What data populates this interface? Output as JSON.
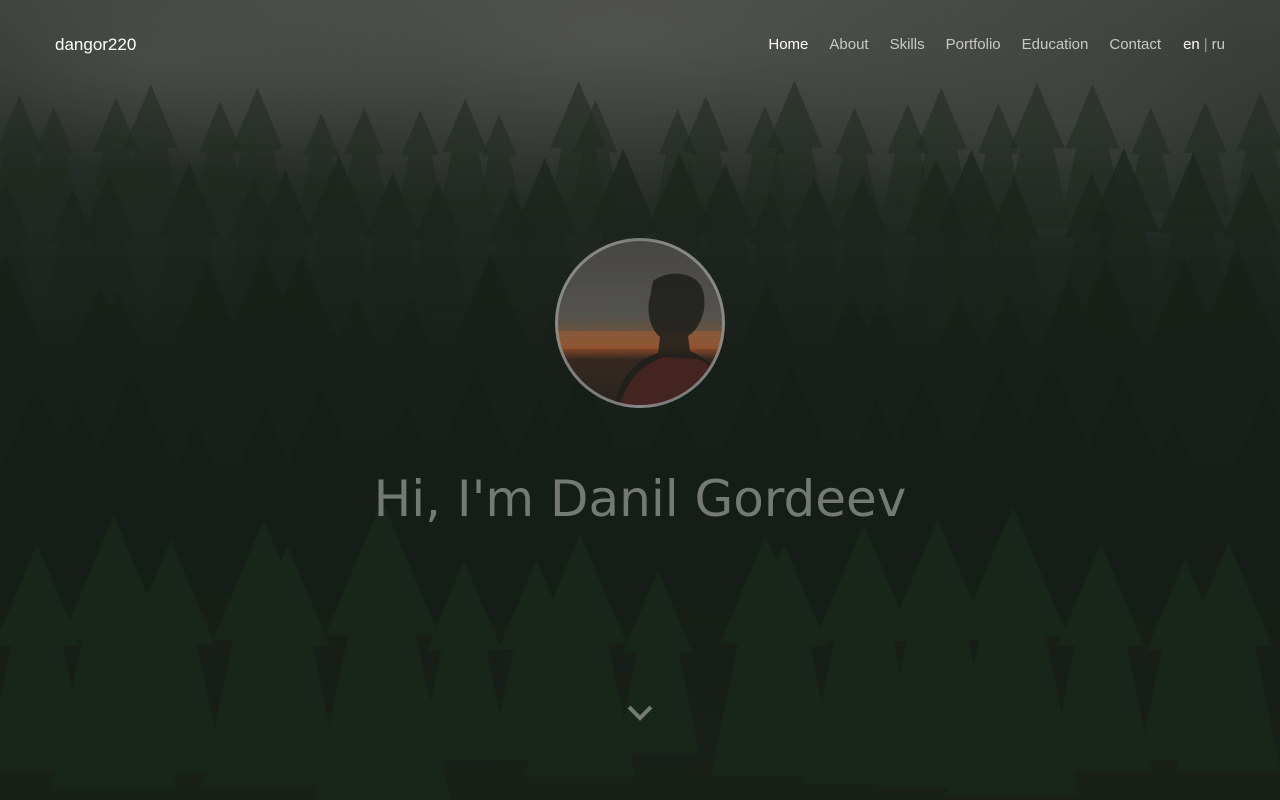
{
  "brand": {
    "name": "dangor220"
  },
  "nav": {
    "items": [
      {
        "label": "Home",
        "active": true
      },
      {
        "label": "About",
        "active": false
      },
      {
        "label": "Skills",
        "active": false
      },
      {
        "label": "Portfolio",
        "active": false
      },
      {
        "label": "Education",
        "active": false
      },
      {
        "label": "Contact",
        "active": false
      }
    ],
    "languages": {
      "current": "en",
      "separator": "|",
      "other": "ru"
    }
  },
  "hero": {
    "avatar_icon": "profile-photo",
    "headline": "Hi, I'm Danil Gordeev",
    "scroll_icon": "chevron-down-icon"
  },
  "colors": {
    "nav_active": "#ffffff",
    "nav_text": "#c9c9c6",
    "headline": "#969896",
    "background": "#1b241b"
  }
}
